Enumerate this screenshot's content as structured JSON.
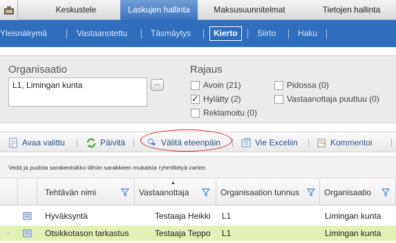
{
  "top_tabs": [
    "Keskustele",
    "Laskujen hallinta",
    "Maksusuunnitelmat",
    "Tietojen hallinta"
  ],
  "sub_nav": [
    "Yleisnäkymä",
    "Vastaanotettu",
    "Täsmäytys",
    "Kierto",
    "Siirto",
    "Haku"
  ],
  "active_sub_nav": "Kierto",
  "filters": {
    "org_label": "Organisaatio",
    "org_value": "L1, Limingan kunta",
    "browse_label": "...",
    "rajaus_label": "Rajaus",
    "checks": [
      {
        "label": "Avoin (21)",
        "checked": false
      },
      {
        "label": "Hylätty (2)",
        "checked": true
      },
      {
        "label": "Reklamoitu (0)",
        "checked": false
      },
      {
        "label": "Pidossa (0)",
        "checked": false
      },
      {
        "label": "Vastaanottaja puuttuu (0)",
        "checked": false
      }
    ]
  },
  "toolbar": {
    "open": "Avaa valittu",
    "refresh": "Päivitä",
    "forward": "Välitä eteenpäin",
    "excel": "Vie Exceliin",
    "comment": "Kommentoi"
  },
  "grid": {
    "group_hint": "Vedä ja pudota sarakeotsikko tähän sarakkeen mukaista ryhmittelyä varten",
    "columns": [
      "Tehtävän nimi",
      "Vastaanottaja",
      "Organisaation tunnus",
      "Organisaatio"
    ],
    "rows": [
      {
        "task": "Hyväksyntä",
        "recipient": "Testaaja Heikki",
        "org_id": "L1",
        "org": "Limingan kunta",
        "selected": false
      },
      {
        "task": "Otsikkotason tarkastus",
        "recipient": "Testaaja Teppo",
        "org_id": "L1",
        "org": "Limingan kunta",
        "selected": true
      }
    ]
  }
}
